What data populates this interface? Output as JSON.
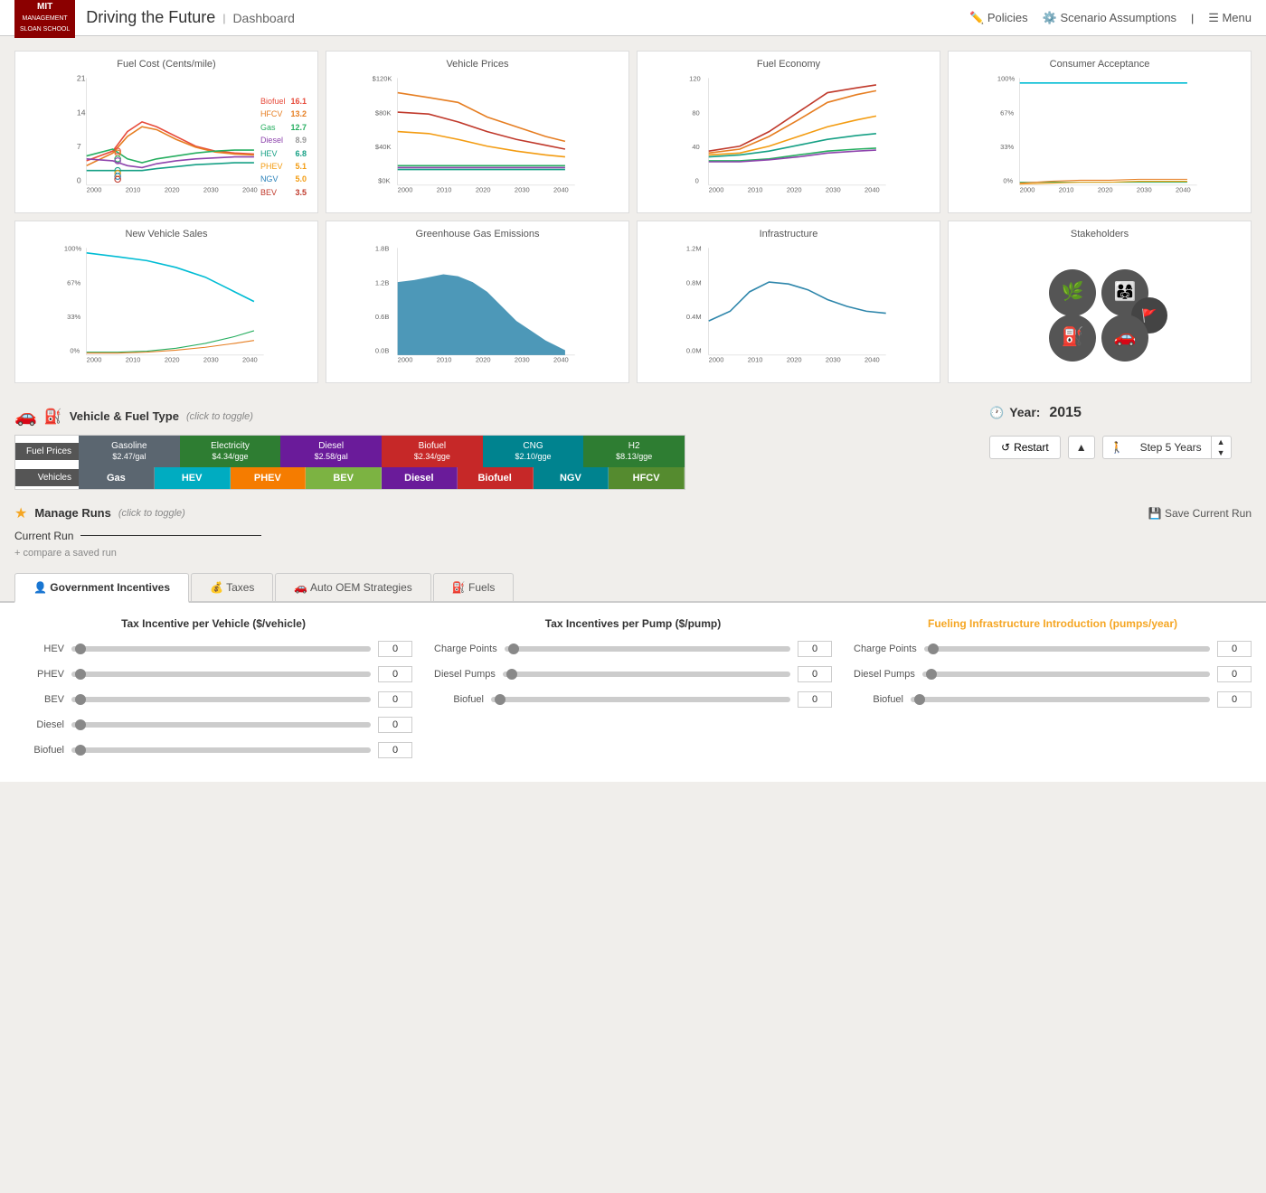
{
  "header": {
    "app_name": "Driving the Future",
    "divider": "|",
    "subtitle": "Dashboard",
    "policies_label": "Policies",
    "scenario_label": "Scenario Assumptions",
    "menu_label": "Menu"
  },
  "charts_row1": [
    {
      "title": "Fuel Cost (Cents/mile)",
      "legend": [
        {
          "name": "Biofuel",
          "color": "#e74c3c",
          "value": "16.1"
        },
        {
          "name": "HFCV",
          "color": "#e67e22",
          "value": "13.2"
        },
        {
          "name": "Gas",
          "color": "#27ae60",
          "value": "12.7"
        },
        {
          "name": "Diesel",
          "color": "#8e44ad",
          "value": "8.9"
        },
        {
          "name": "HEV",
          "color": "#16a085",
          "value": "6.8"
        },
        {
          "name": "PHEV",
          "color": "#f39c12",
          "value": "5.1"
        },
        {
          "name": "NGV",
          "color": "#2980b9",
          "value": "5.0"
        },
        {
          "name": "BEV",
          "color": "#c0392b",
          "value": "3.5"
        }
      ],
      "y_max": "21",
      "y_mid": "14",
      "y_low": "7",
      "y_zero": "0",
      "x_start": "2000",
      "x_end": "2050"
    },
    {
      "title": "Vehicle Prices",
      "y_max": "$120K",
      "y_mid": "$80K",
      "y_low": "$40K",
      "y_zero": "$0K",
      "x_start": "2000",
      "x_end": "2050"
    },
    {
      "title": "Fuel Economy",
      "y_max": "120",
      "y_mid": "80",
      "y_low": "40",
      "y_zero": "0",
      "x_start": "2000",
      "x_end": "2050"
    },
    {
      "title": "Consumer Acceptance",
      "y_max": "100%",
      "y_mid": "67%",
      "y_low": "33%",
      "y_zero": "0%",
      "x_start": "2000",
      "x_end": "2050"
    }
  ],
  "charts_row2": [
    {
      "title": "New Vehicle Sales",
      "y_max": "100%",
      "y_mid": "67%",
      "y_low": "33%",
      "y_zero": "0%",
      "x_start": "2000",
      "x_end": "2050"
    },
    {
      "title": "Greenhouse Gas Emissions",
      "y_max": "1.8B",
      "y_mid": "1.2B",
      "y_low": "0.6B",
      "y_zero": "0.0B",
      "x_start": "2000",
      "x_end": "2050"
    },
    {
      "title": "Infrastructure",
      "y_max": "1.2M",
      "y_mid": "0.8M",
      "y_low": "0.4M",
      "y_zero": "0.0M",
      "x_start": "2000",
      "x_end": "2050"
    },
    {
      "title": "Stakeholders"
    }
  ],
  "vehicle_fuel": {
    "header": "Vehicle & Fuel Type",
    "toggle_hint": "(click to toggle)",
    "fuel_label": "Fuel Prices",
    "vehicle_label": "Vehicles",
    "fuels": [
      {
        "name": "Gasoline",
        "price": "$2.47/gal",
        "color": "#5b6670"
      },
      {
        "name": "Electricity",
        "price": "$4.34/gge",
        "color": "#2e7d32"
      },
      {
        "name": "Diesel",
        "price": "$2.58/gal",
        "color": "#6a1b9a"
      },
      {
        "name": "Biofuel",
        "price": "$2.34/gge",
        "color": "#c62828"
      },
      {
        "name": "CNG",
        "price": "$2.10/gge",
        "color": "#00838f"
      },
      {
        "name": "H2",
        "price": "$8.13/gge",
        "color": "#2e7d32"
      }
    ],
    "vehicles": [
      {
        "name": "Gas",
        "color": "#5b6670"
      },
      {
        "name": "HEV",
        "color": "#00acc1"
      },
      {
        "name": "PHEV",
        "color": "#f57c00"
      },
      {
        "name": "BEV",
        "color": "#7cb342"
      },
      {
        "name": "Diesel",
        "color": "#6a1b9a"
      },
      {
        "name": "Biofuel",
        "color": "#c62828"
      },
      {
        "name": "NGV",
        "color": "#00838f"
      },
      {
        "name": "HFCV",
        "color": "#558b2f"
      }
    ]
  },
  "year_controls": {
    "label": "Year:",
    "value": "2015",
    "restart_label": "Restart",
    "step_label": "Step 5 Years"
  },
  "manage_runs": {
    "title": "Manage Runs",
    "toggle_hint": "(click to toggle)",
    "save_label": "Save Current Run",
    "current_run_label": "Current Run",
    "compare_label": "+ compare a saved run"
  },
  "policy_tabs": [
    {
      "label": "Government Incentives",
      "active": true
    },
    {
      "label": "Taxes",
      "active": false
    },
    {
      "label": "Auto OEM Strategies",
      "active": false
    },
    {
      "label": "Fuels",
      "active": false
    }
  ],
  "sliders": {
    "col1_title": "Tax Incentive per Vehicle ($/vehicle)",
    "col2_title": "Tax Incentives per Pump ($/pump)",
    "col3_title": "Fueling Infrastructure Introduction (pumps/year)",
    "col1_rows": [
      {
        "label": "HEV",
        "value": "0"
      },
      {
        "label": "PHEV",
        "value": "0"
      },
      {
        "label": "BEV",
        "value": "0"
      },
      {
        "label": "Diesel",
        "value": "0"
      },
      {
        "label": "Biofuel",
        "value": "0"
      }
    ],
    "col2_rows": [
      {
        "label": "Charge Points",
        "value": "0"
      },
      {
        "label": "Diesel Pumps",
        "value": "0"
      },
      {
        "label": "Biofuel",
        "value": "0"
      }
    ],
    "col3_rows": [
      {
        "label": "Charge Points",
        "value": "0"
      },
      {
        "label": "Diesel Pumps",
        "value": "0"
      },
      {
        "label": "Biofuel",
        "value": "0"
      }
    ]
  }
}
